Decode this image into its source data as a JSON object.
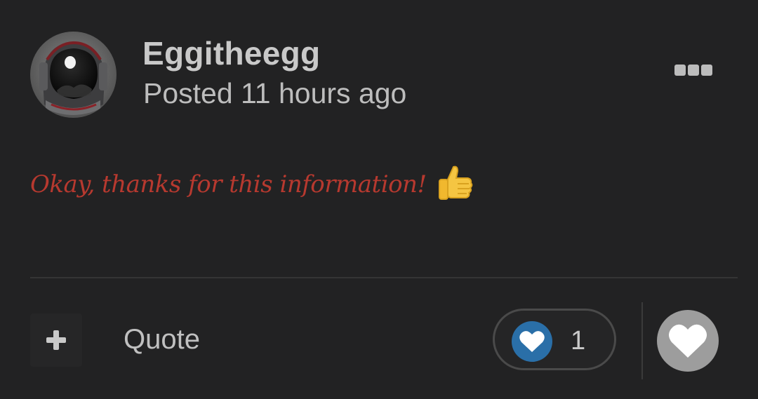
{
  "post": {
    "author": {
      "name": "Eggitheegg",
      "avatar_icon": "astronaut-helmet-avatar"
    },
    "posted_label": "Posted 11 hours ago",
    "message": "Okay, thanks for this information!",
    "message_emoji": "thumbs-up-icon",
    "message_color": "#b7392f"
  },
  "footer": {
    "add_icon": "plus-icon",
    "quote_label": "Quote",
    "reactions": {
      "icon": "heart-icon",
      "count": "1",
      "icon_color": "#2a6fa8"
    },
    "like_icon": "heart-icon"
  },
  "menu": {
    "icon": "ellipsis-icon"
  },
  "colors": {
    "background": "#222223",
    "text_primary": "#c9c9c9",
    "text_secondary": "#bdbdbd"
  }
}
